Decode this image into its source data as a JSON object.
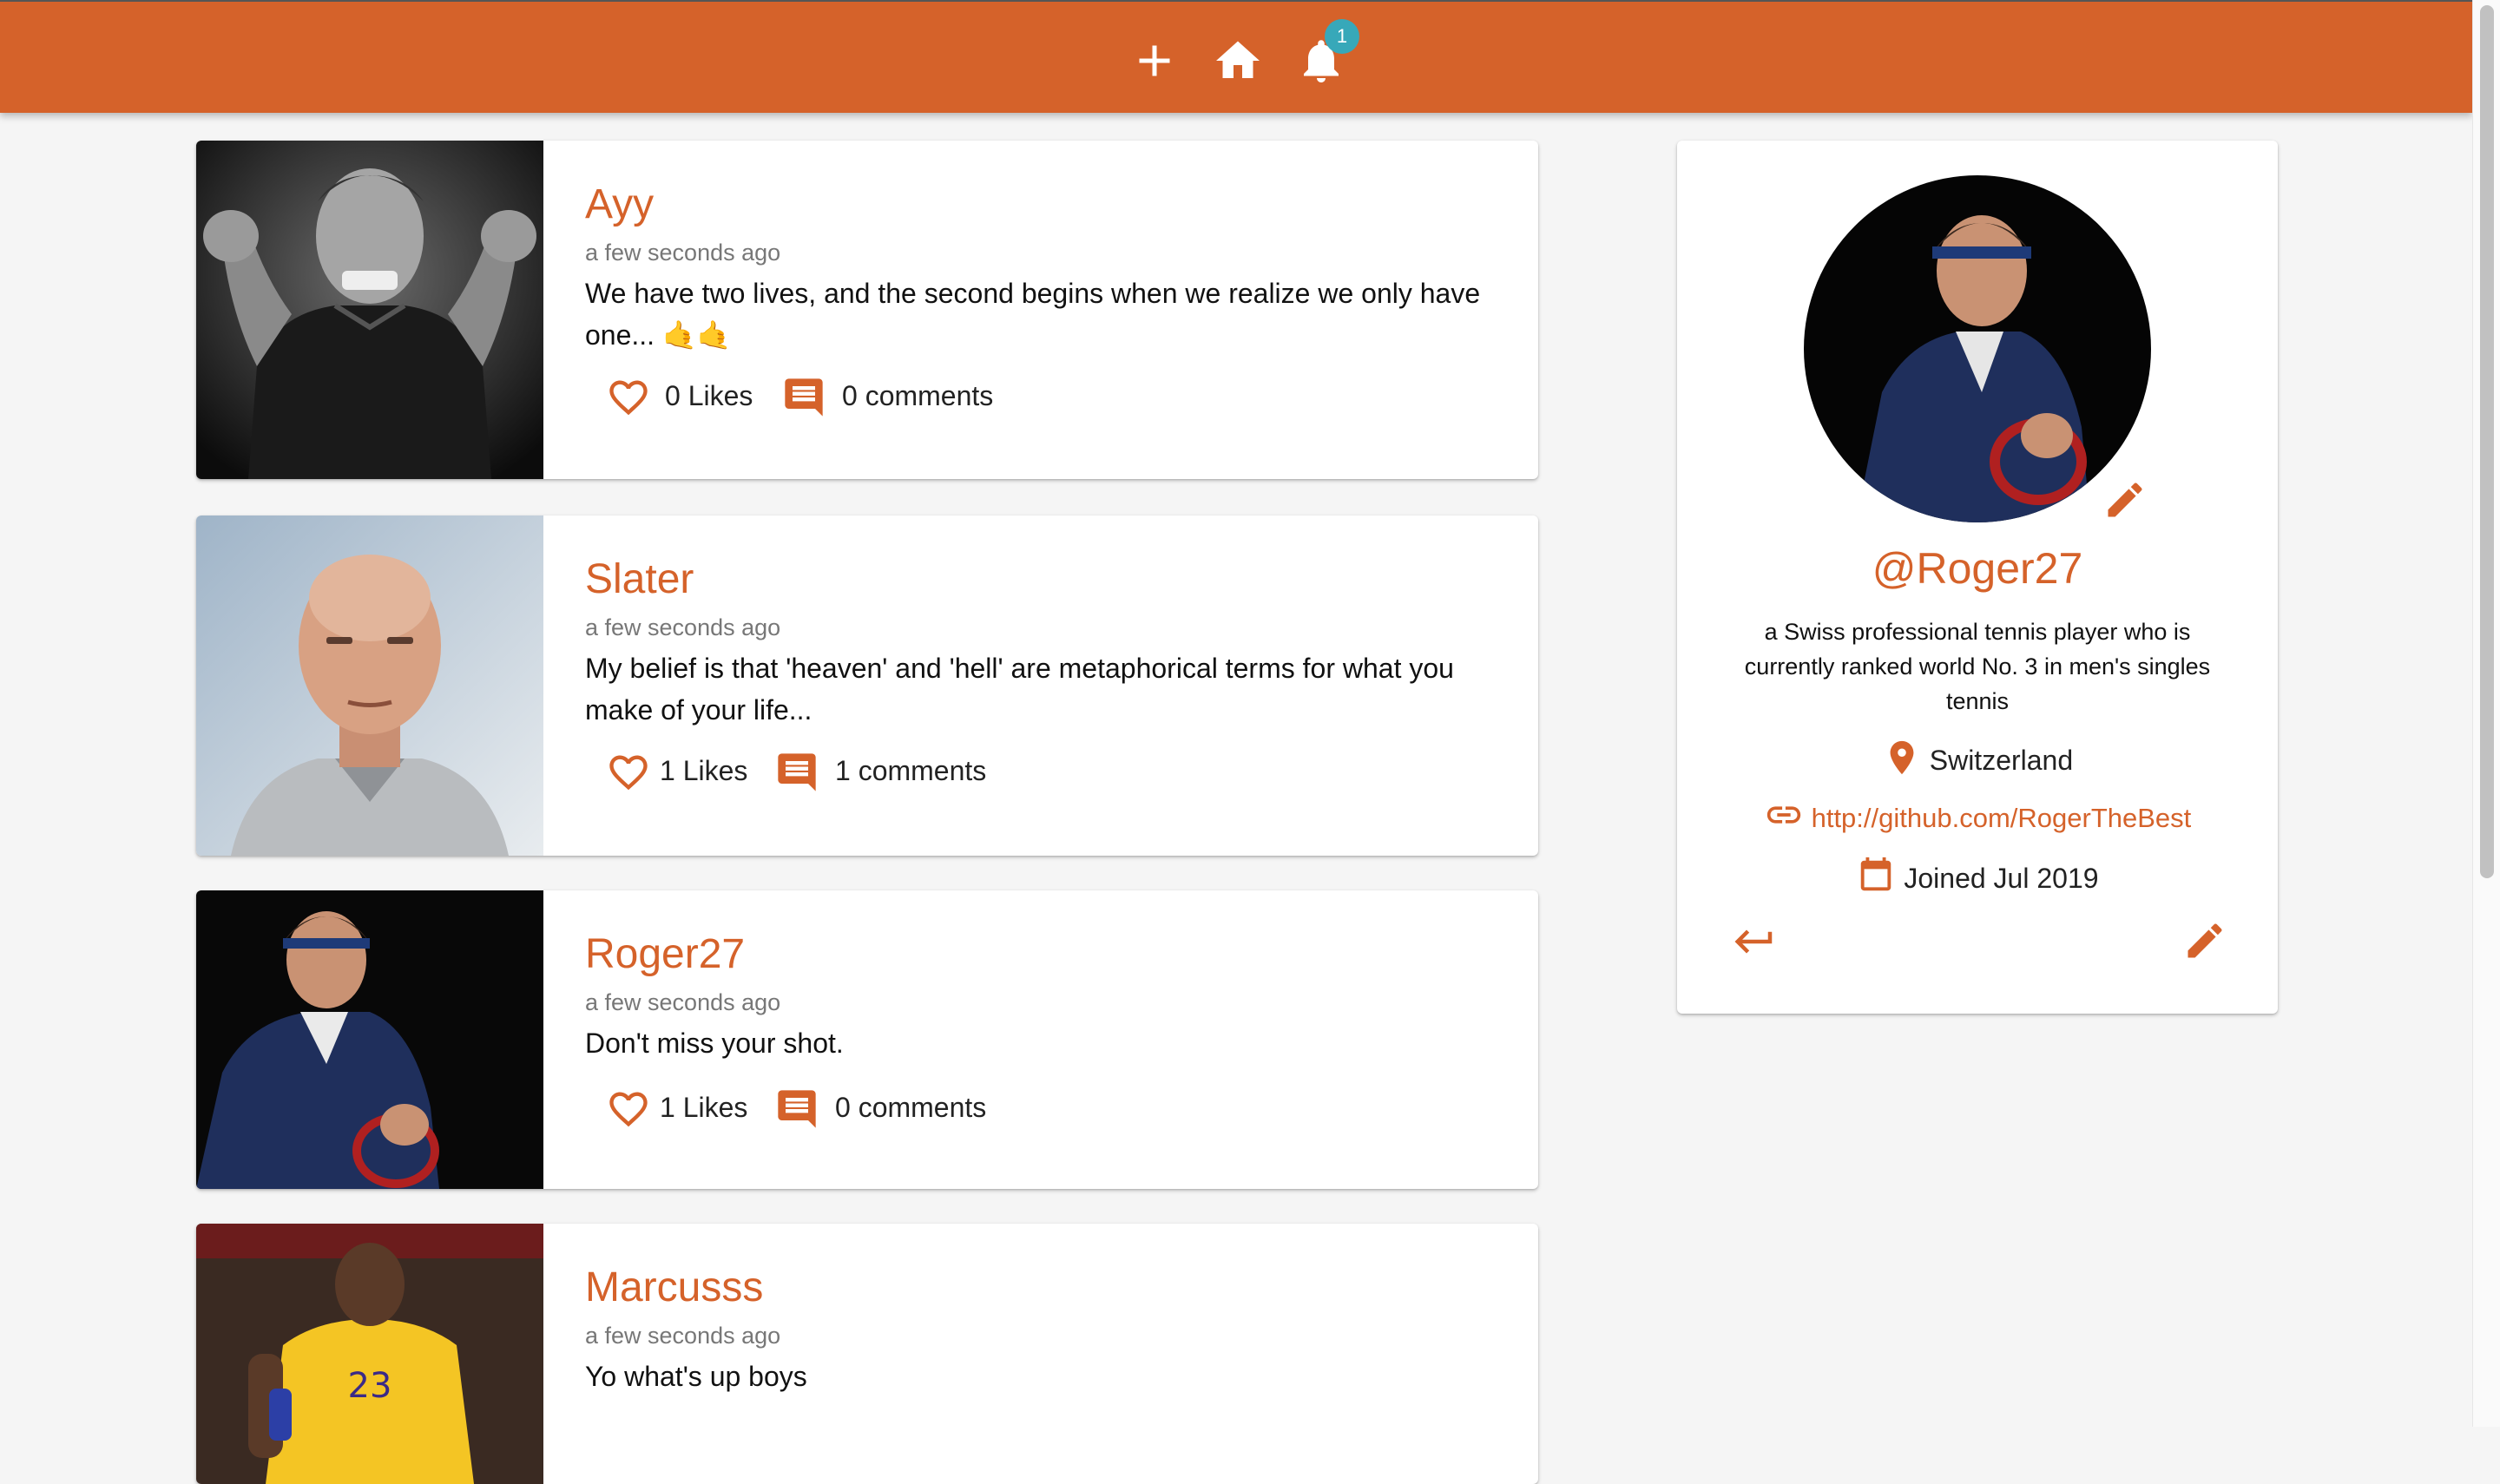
{
  "navbar": {
    "add_icon": "plus-icon",
    "home_icon": "home-icon",
    "notifications_icon": "bell-icon",
    "notification_count": "1",
    "background": "#d5622a"
  },
  "posts": [
    {
      "user": "Ayy",
      "time": "a few seconds ago",
      "body": "We have two lives, and the second begins when we realize we only have one... 🤙🤙",
      "likes": "0 Likes",
      "comments": "0 comments",
      "deletable": false
    },
    {
      "user": "Slater",
      "time": "a few seconds ago",
      "body": "My belief is that 'heaven' and 'hell' are metaphorical terms for what you make of your life...",
      "likes": "1 Likes",
      "comments": "1 comments",
      "deletable": false
    },
    {
      "user": "Roger27",
      "time": "a few seconds ago",
      "body": "Don't miss your shot.",
      "likes": "1 Likes",
      "comments": "0 comments",
      "deletable": true
    },
    {
      "user": "Marcusss",
      "time": "a few seconds ago",
      "body": "Yo what's up boys",
      "likes": "",
      "comments": "",
      "deletable": false
    }
  ],
  "profile": {
    "handle": "@Roger27",
    "bio": "a Swiss professional tennis player who is currently ranked world No. 3 in men's singles tennis",
    "location": "Switzerland",
    "website": "http://github.com/RogerTheBest",
    "joined": "Joined Jul 2019"
  },
  "colors": {
    "accent": "#d5622a",
    "teal": "#37a8b9",
    "background": "#f5f5f5"
  }
}
